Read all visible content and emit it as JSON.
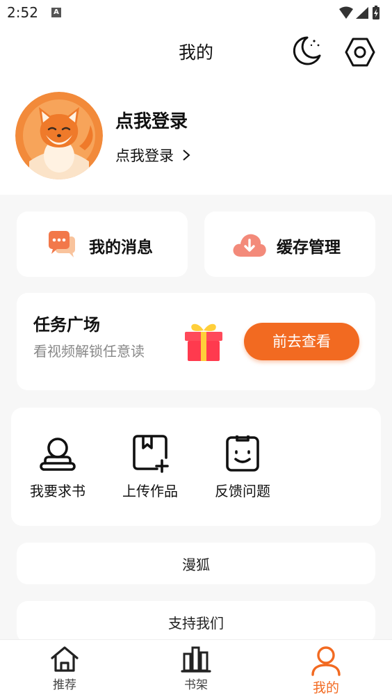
{
  "status_bar": {
    "time": "2:52",
    "notification_letter": "A"
  },
  "header": {
    "title": "我的"
  },
  "profile": {
    "name": "点我登录",
    "login_link": "点我登录"
  },
  "quick_actions": [
    {
      "label": "我的消息",
      "icon": "chat-bubbles-icon"
    },
    {
      "label": "缓存管理",
      "icon": "cloud-download-icon"
    }
  ],
  "task": {
    "title": "任务广场",
    "subtitle": "看视频解锁任意读",
    "button_label": "前去查看",
    "icon": "gift-icon"
  },
  "tools": [
    {
      "label": "我要求书",
      "icon": "request-book-icon"
    },
    {
      "label": "上传作品",
      "icon": "upload-work-icon"
    },
    {
      "label": "反馈问题",
      "icon": "feedback-icon"
    }
  ],
  "rows": [
    {
      "label": "漫狐"
    },
    {
      "label": "支持我们"
    }
  ],
  "bottom_nav": [
    {
      "label": "推荐",
      "icon": "home-icon",
      "active": false
    },
    {
      "label": "书架",
      "icon": "bookshelf-icon",
      "active": false
    },
    {
      "label": "我的",
      "icon": "user-icon",
      "active": true
    }
  ],
  "colors": {
    "accent": "#f26a21",
    "background": "#f7f7f7",
    "card": "#ffffff",
    "muted_text": "#888888"
  }
}
